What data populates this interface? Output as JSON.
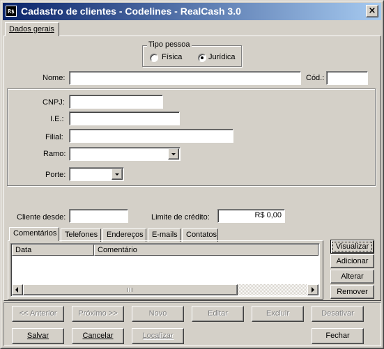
{
  "window": {
    "title": "Cadastro de clientes - Codelines - RealCash 3.0",
    "icon_text": "R$",
    "close_glyph": "×"
  },
  "main_tab": {
    "label": "Dados gerais"
  },
  "tipo_pessoa": {
    "legend": "Tipo pessoa",
    "options": [
      {
        "label": "Física",
        "checked": false
      },
      {
        "label": "Jurídica",
        "checked": true
      }
    ]
  },
  "fields": {
    "nome": {
      "label": "Nome:",
      "value": ""
    },
    "cod": {
      "label": "Cód.:",
      "value": ""
    },
    "cnpj": {
      "label": "CNPJ:",
      "value": ""
    },
    "ie": {
      "label": "I.E.:",
      "value": ""
    },
    "filial": {
      "label": "Filial:",
      "value": ""
    },
    "ramo": {
      "label": "Ramo:",
      "value": ""
    },
    "porte": {
      "label": "Porte:",
      "value": ""
    },
    "cliente_desde": {
      "label": "Cliente desde:",
      "value": ""
    },
    "limite_credito": {
      "label": "Limite de crédito:",
      "value": "R$ 0,00"
    }
  },
  "subtabs": [
    "Comentários",
    "Telefones",
    "Endereços",
    "E-mails",
    "Contatos"
  ],
  "grid": {
    "columns": [
      "Data",
      "Comentário"
    ],
    "rows": []
  },
  "side_buttons": [
    "Visualizar",
    "Adicionar",
    "Alterar",
    "Remover"
  ],
  "nav_buttons": [
    "<< Anterior",
    "Próximo >>",
    "Novo",
    "Editar",
    "Excluir",
    "Desativar"
  ],
  "action_buttons": [
    "Salvar",
    "Cancelar",
    "Localizar",
    "Fechar"
  ],
  "colors": {
    "title_start": "#0a246a",
    "title_end": "#a6caf0",
    "face": "#d4d0c8",
    "disabled_text": "#808080"
  }
}
